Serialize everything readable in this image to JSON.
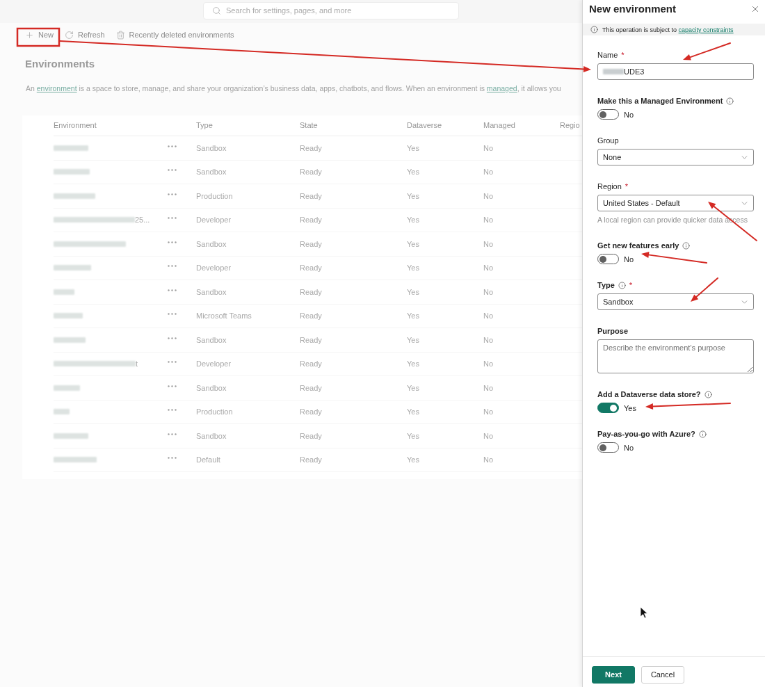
{
  "search": {
    "placeholder": "Search for settings, pages, and more"
  },
  "toolbar": [
    {
      "kind": "new",
      "label": "New"
    },
    {
      "kind": "refresh",
      "label": "Refresh"
    },
    {
      "kind": "deleted",
      "label": "Recently deleted environments"
    }
  ],
  "page": {
    "title": "Environments",
    "description": [
      {
        "text": "An "
      },
      {
        "text": "environment",
        "link": true
      },
      {
        "text": " is a space to store, manage, and share your organization’s business data, apps, chatbots, and flows. When an environment is "
      },
      {
        "text": "managed",
        "link": true
      },
      {
        "text": ", it allows you"
      }
    ]
  },
  "table": {
    "columns": [
      "Environment",
      "Type",
      "State",
      "Dataverse",
      "Managed",
      "Regio"
    ],
    "rows": [
      {
        "type": "Sandbox",
        "state": "Ready",
        "dataverse": "Yes",
        "managed": "No"
      },
      {
        "type": "Sandbox",
        "state": "Ready",
        "dataverse": "Yes",
        "managed": "No"
      },
      {
        "type": "Production",
        "state": "Ready",
        "dataverse": "Yes",
        "managed": "No"
      },
      {
        "environment_tail": "25...",
        "type": "Developer",
        "state": "Ready",
        "dataverse": "Yes",
        "managed": "No"
      },
      {
        "type": "Sandbox",
        "state": "Ready",
        "dataverse": "Yes",
        "managed": "No"
      },
      {
        "type": "Developer",
        "state": "Ready",
        "dataverse": "Yes",
        "managed": "No"
      },
      {
        "type": "Sandbox",
        "state": "Ready",
        "dataverse": "Yes",
        "managed": "No"
      },
      {
        "type": "Microsoft Teams",
        "state": "Ready",
        "dataverse": "Yes",
        "managed": "No"
      },
      {
        "type": "Sandbox",
        "state": "Ready",
        "dataverse": "Yes",
        "managed": "No"
      },
      {
        "environment_tail": "t",
        "type": "Developer",
        "state": "Ready",
        "dataverse": "Yes",
        "managed": "No"
      },
      {
        "type": "Sandbox",
        "state": "Ready",
        "dataverse": "Yes",
        "managed": "No"
      },
      {
        "type": "Production",
        "state": "Ready",
        "dataverse": "Yes",
        "managed": "No"
      },
      {
        "type": "Sandbox",
        "state": "Ready",
        "dataverse": "Yes",
        "managed": "No"
      },
      {
        "type": "Default",
        "state": "Ready",
        "dataverse": "Yes",
        "managed": "No"
      }
    ]
  },
  "panel": {
    "title": "New environment",
    "notice": {
      "text": "This operation is subject to",
      "link": "capacity constraints"
    },
    "fields": [
      {
        "kind": "text",
        "label": "Name",
        "label_bold": false,
        "required_mark": "*",
        "value": "UDE3"
      },
      {
        "kind": "toggle",
        "label": "Make this a Managed Environment",
        "label_bold": true,
        "info": true,
        "on": false,
        "state_text": "No"
      },
      {
        "kind": "select",
        "label": "Group",
        "label_bold": false,
        "value": "None"
      },
      {
        "kind": "select",
        "label": "Region",
        "label_bold": false,
        "required_mark": "*",
        "value": "United States - Default",
        "helper": "A local region can provide quicker data access"
      },
      {
        "kind": "toggle",
        "label": "Get new features early",
        "label_bold": true,
        "info": true,
        "on": false,
        "state_text": "No"
      },
      {
        "kind": "select",
        "label": "Type",
        "label_bold": true,
        "info": true,
        "required_mark": "*",
        "value": "Sandbox"
      },
      {
        "kind": "textarea",
        "label": "Purpose",
        "label_bold": true,
        "placeholder": "Describe the environment’s purpose"
      },
      {
        "kind": "toggle",
        "label": "Add a Dataverse data store?",
        "label_bold": true,
        "info": true,
        "on": true,
        "state_text": "Yes"
      },
      {
        "kind": "toggle",
        "label": "Pay-as-you-go with Azure?",
        "label_bold": true,
        "info": true,
        "on": false,
        "state_text": "No"
      }
    ],
    "buttons": [
      {
        "kind": "primary",
        "label": "Next"
      },
      {
        "kind": "secondary",
        "label": "Cancel"
      }
    ]
  }
}
